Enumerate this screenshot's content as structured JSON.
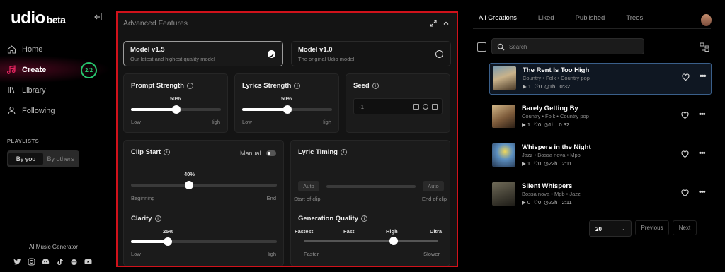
{
  "brand": {
    "name": "udio",
    "badge": "beta"
  },
  "nav": [
    {
      "label": "Home",
      "icon": "home-icon"
    },
    {
      "label": "Create",
      "icon": "music-note-icon",
      "badge": "2/2"
    },
    {
      "label": "Library",
      "icon": "library-icon"
    },
    {
      "label": "Following",
      "icon": "user-icon"
    }
  ],
  "playlists": {
    "title": "PLAYLISTS",
    "tabs": [
      "By you",
      "By others"
    ]
  },
  "footer": {
    "tagline": "AI Music Generator",
    "socials": [
      "twitter-icon",
      "instagram-icon",
      "discord-icon",
      "tiktok-icon",
      "reddit-icon",
      "youtube-icon"
    ]
  },
  "panel": {
    "title": "Advanced Features",
    "models": [
      {
        "name": "Model v1.5",
        "desc": "Our latest and highest quality model",
        "selected": true
      },
      {
        "name": "Model v1.0",
        "desc": "The original Udio model",
        "selected": false
      }
    ],
    "prompt_strength": {
      "label": "Prompt Strength",
      "value": "50%",
      "level": 0.5,
      "min": "Low",
      "max": "High"
    },
    "lyrics_strength": {
      "label": "Lyrics Strength",
      "value": "50%",
      "level": 0.5,
      "min": "Low",
      "max": "High"
    },
    "seed": {
      "label": "Seed",
      "value": "-1"
    },
    "clip_start": {
      "label": "Clip Start",
      "manual": "Manual",
      "value": "40%",
      "level": 0.4,
      "min": "Beginning",
      "max": "End"
    },
    "lyric_timing": {
      "label": "Lyric Timing",
      "auto_left": "Auto",
      "auto_right": "Auto",
      "min": "Start of clip",
      "max": "End of clip"
    },
    "clarity": {
      "label": "Clarity",
      "value": "25%",
      "level": 0.25,
      "min": "Low",
      "max": "High"
    },
    "generation_quality": {
      "label": "Generation Quality",
      "ticks": [
        "Fastest",
        "Fast",
        "High",
        "Ultra"
      ],
      "level": 0.667,
      "min": "Faster",
      "max": "Slower"
    }
  },
  "creations": {
    "tabs": [
      "All Creations",
      "Liked",
      "Published",
      "Trees"
    ],
    "search_placeholder": "Search",
    "songs": [
      {
        "title": "The Rent Is Too High",
        "tags": "Country   •   Folk   •   Country pop",
        "plays": "1",
        "likes": "0",
        "age": "1h",
        "duration": "0:32",
        "active": true
      },
      {
        "title": "Barely Getting By",
        "tags": "Country   •   Folk   •   Country pop",
        "plays": "1",
        "likes": "0",
        "age": "1h",
        "duration": "0:32",
        "active": false
      },
      {
        "title": "Whispers in the Night",
        "tags": "Jazz   •   Bossa nova   •   Mpb",
        "plays": "1",
        "likes": "0",
        "age": "22h",
        "duration": "2:11",
        "active": false
      },
      {
        "title": "Silent Whispers",
        "tags": "Bossa nova   •   Mpb   •   Jazz",
        "plays": "0",
        "likes": "0",
        "age": "22h",
        "duration": "2:11",
        "active": false
      }
    ],
    "pager": {
      "per_page": "20",
      "prev": "Previous",
      "next": "Next"
    }
  },
  "colors": {
    "accent_red": "#d0121b",
    "badge_green": "#28c76f",
    "active_blue": "#3a5f8a"
  }
}
